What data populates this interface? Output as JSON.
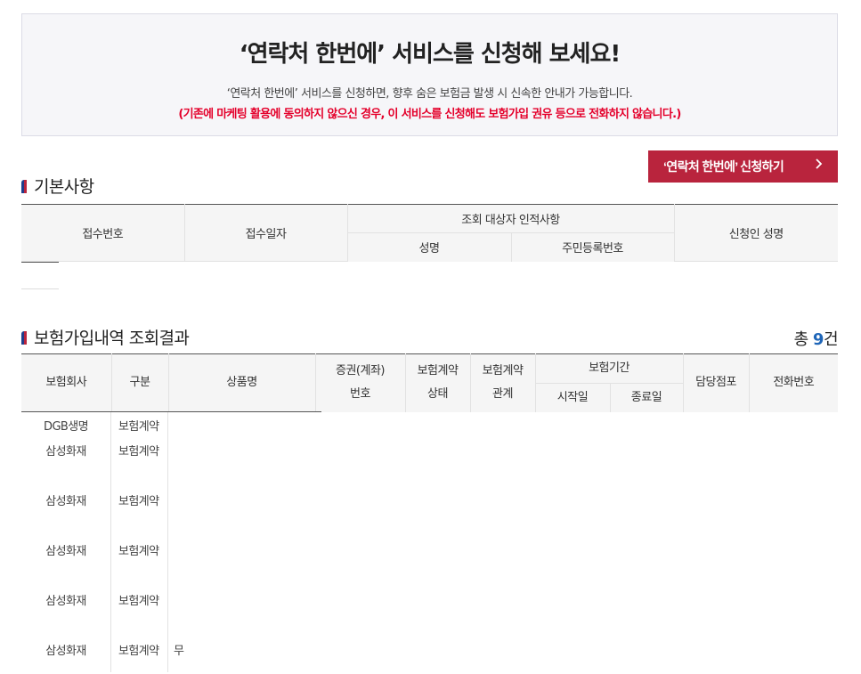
{
  "banner": {
    "title": "‘연락처 한번에’ 서비스를 신청해 보세요!",
    "description": "‘연락처 한번에’ 서비스를 신청하면, 향후 숨은 보험금 발생 시 신속한 안내가 가능합니다.",
    "warning": "(기존에 마케팅 활용에 동의하지 않으신 경우, 이 서비스를 신청해도 보험가입 권유 등으로 전화하지 않습니다.)"
  },
  "apply_button": {
    "label": "‘연락처 한번에’ 신청하기",
    "icon": "chevron-right-icon"
  },
  "basic_section": {
    "title": "기본사항",
    "headers": {
      "receipt_no": "접수번호",
      "receipt_date": "접수일자",
      "target_group": "조회 대상자 인적사항",
      "name": "성명",
      "resident_no": "주민등록번호",
      "applicant_name": "신청인 성명"
    }
  },
  "results_section": {
    "title": "보험가입내역 조회결과",
    "total_prefix": "총 ",
    "total_count": "9",
    "total_suffix": "건",
    "headers": {
      "company": "보험회사",
      "type": "구분",
      "product": "상품명",
      "policy_no_1": "증권(계좌)",
      "policy_no_2": "번호",
      "status_1": "보험계약",
      "status_2": "상태",
      "relation_1": "보험계약",
      "relation_2": "관계",
      "period": "보험기간",
      "start": "시작일",
      "end": "종료일",
      "branch": "담당점포",
      "phone": "전화번호"
    },
    "rows": [
      {
        "company": "DGB생명",
        "type": "보험계약",
        "product": ""
      },
      {
        "company": "삼성화재",
        "type": "보험계약",
        "product": ""
      },
      {
        "company": "삼성화재",
        "type": "보험계약",
        "product": ""
      },
      {
        "company": "삼성화재",
        "type": "보험계약",
        "product": ""
      },
      {
        "company": "삼성화재",
        "type": "보험계약",
        "product": ""
      },
      {
        "company": "삼성화재",
        "type": "보험계약",
        "product": "무"
      }
    ]
  },
  "colors": {
    "accent": "#b9243d",
    "navy": "#1f3e8c",
    "count": "#1f66b8",
    "warning": "#e4002b"
  }
}
